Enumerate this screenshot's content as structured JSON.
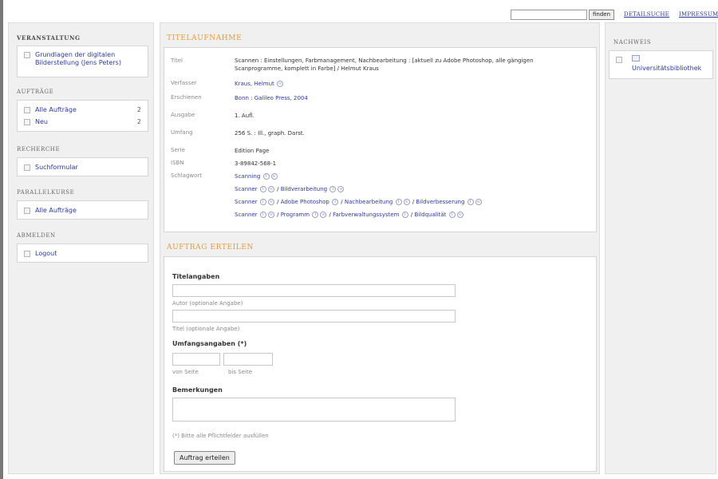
{
  "topbar": {
    "finden": "finden",
    "detailsuche": "DETAILSUCHE",
    "impressum": "IMPRESSUM"
  },
  "left": {
    "veranstaltung": "VERANSTALTUNG",
    "course_title": [
      "Grundlagen der digitalen",
      "Bilderstellung (Jens Peters)"
    ],
    "auftraege": "AUFTRÄGE",
    "alle_auftraege": "Alle Aufträge",
    "alle_count": "2",
    "neu": "Neu",
    "neu_count": "2",
    "recherche": "RECHERCHE",
    "suchformular": "Suchformular",
    "parallelkurse": "PARALLELKURSE",
    "parallel_alle": "Alle Aufträge",
    "abmelden": "ABMELDEN",
    "logout": "Logout"
  },
  "titelaufnahme": {
    "heading": "TITELAUFNAHME",
    "rows": [
      {
        "label": "Titel",
        "value": [
          "Scannen : Einstellungen, Farbmanagement, Nachbearbeitung : [aktuell zu Adobe Photoshop, alle gängigen",
          "Scanprogramme, komplett in Farbe] / Helmut Kraus"
        ]
      },
      {
        "label": "Verfasser",
        "value": "Kraus, Helmut"
      },
      {
        "label": "Erschienen",
        "value": "Bonn : Galileo Press, 2004"
      },
      {
        "label": "Ausgabe",
        "value": "1. Aufl."
      },
      {
        "label": "Umfang",
        "value": "256 S. : Ill., graph. Darst."
      },
      {
        "label": "Serie",
        "value": "Edition Page"
      },
      {
        "label": "ISBN",
        "value": "3-89842-568-1"
      },
      {
        "label": "Schlagwort",
        "value": ""
      }
    ],
    "keywords": [
      [
        "Scanning"
      ],
      [
        "Scanner",
        "Bildverarbeitung"
      ],
      [
        "Scanner",
        "Adobe Photoshop",
        "Nachbearbeitung",
        "Bildverbesserung"
      ],
      [
        "Scanner",
        "Programm",
        "Farbverwaltungssystem",
        "Bildqualität"
      ]
    ]
  },
  "auftrag": {
    "heading": "AUFTRAG ERTEILEN",
    "titelangaben": "Titelangaben",
    "autor_hint": "Autor (optionale Angabe)",
    "titel_hint": "Titel (optionale Angabe)",
    "umfang": "Umfangsangaben (*)",
    "von_seite": "von Seite",
    "bis_seite": "bis Seite",
    "bemerkungen": "Bemerkungen",
    "pflicht": "(*) Bitte alle Pflichtfelder ausfüllen",
    "submit": "Auftrag erteilen"
  },
  "right": {
    "nachweis": "NACHWEIS",
    "ub": "Universitätsbibliothek"
  }
}
